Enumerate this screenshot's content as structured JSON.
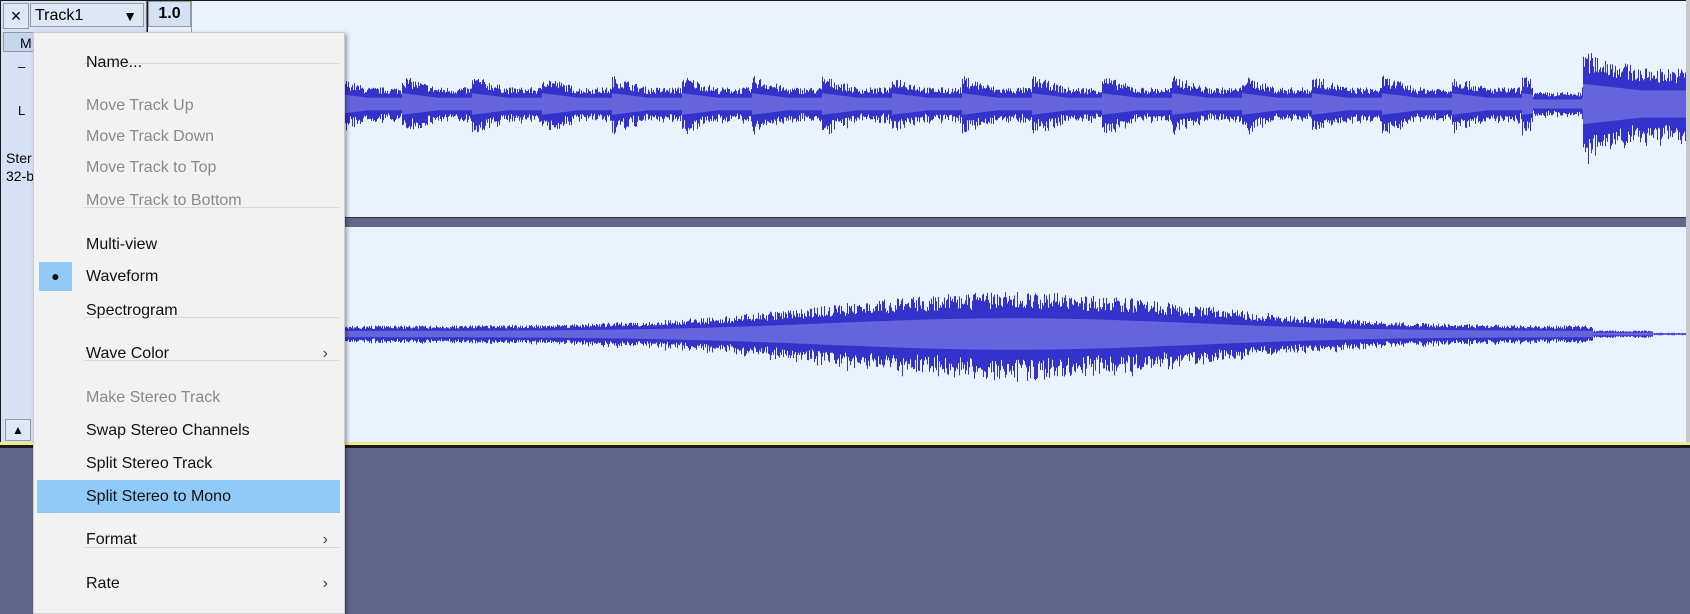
{
  "track": {
    "close_icon": "×",
    "name": "Track1",
    "dropdown_icon": "▼",
    "ruler_top": "1.0",
    "mute_label": "M",
    "gain_label": "–",
    "pan_label": "L",
    "info_line1": "Ster",
    "info_line2": "32-b",
    "collapse_icon": "▲",
    "wave_color": "#3333cc",
    "wave_rms_color": "#6464dc",
    "background": "#eaf2fd"
  },
  "menu": {
    "items": [
      {
        "label": "Name...",
        "enabled": true
      },
      {
        "label": "Move Track Up",
        "enabled": false
      },
      {
        "label": "Move Track Down",
        "enabled": false
      },
      {
        "label": "Move Track to Top",
        "enabled": false
      },
      {
        "label": "Move Track to Bottom",
        "enabled": false
      },
      {
        "label": "Multi-view",
        "enabled": true
      },
      {
        "label": "Waveform",
        "enabled": true,
        "checked": true,
        "check_icon": "●"
      },
      {
        "label": "Spectrogram",
        "enabled": true
      },
      {
        "label": "Wave Color",
        "enabled": true,
        "submenu_icon": "›"
      },
      {
        "label": "Make Stereo Track",
        "enabled": false
      },
      {
        "label": "Swap Stereo Channels",
        "enabled": true
      },
      {
        "label": "Split Stereo Track",
        "enabled": true
      },
      {
        "label": "Split Stereo to Mono",
        "enabled": true,
        "highlighted": true
      },
      {
        "label": "Format",
        "enabled": true,
        "submenu_icon": "›"
      },
      {
        "label": "Rate",
        "enabled": true,
        "submenu_icon": "›"
      }
    ]
  }
}
